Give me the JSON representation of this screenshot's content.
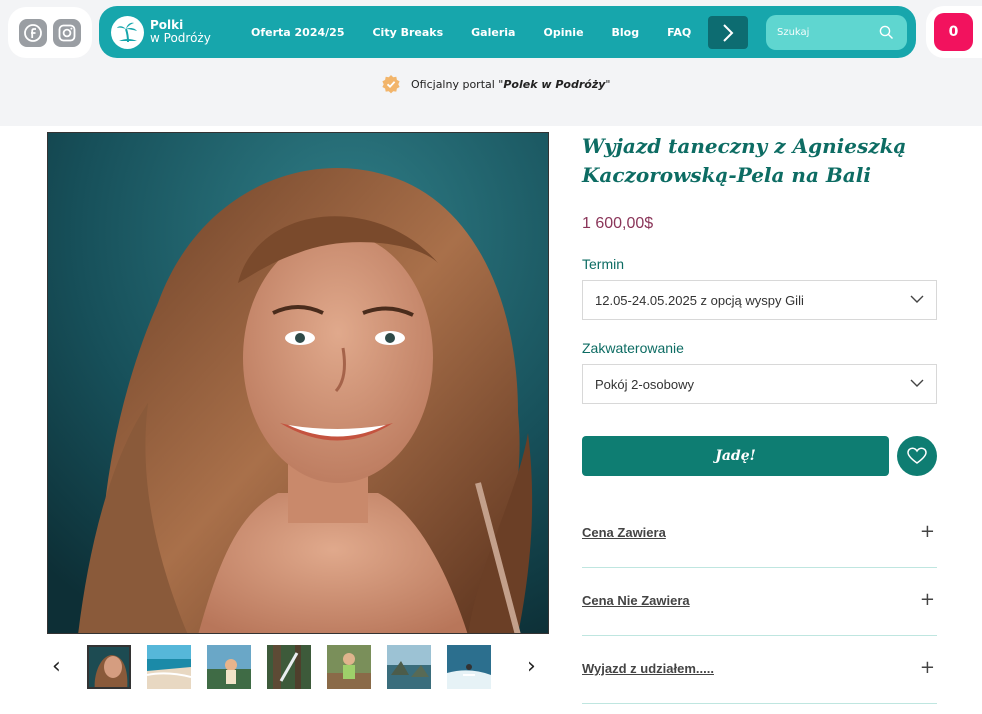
{
  "header": {
    "social": [
      {
        "icon": "facebook-icon"
      },
      {
        "icon": "instagram-icon"
      }
    ],
    "logo": {
      "line1": "Polki",
      "line2": "w Podróży"
    },
    "nav": [
      {
        "label": "Oferta 2024/25"
      },
      {
        "label": "City Breaks"
      },
      {
        "label": "Galeria"
      },
      {
        "label": "Opinie"
      },
      {
        "label": "Blog"
      },
      {
        "label": "FAQ"
      }
    ],
    "search": {
      "placeholder": "Szukaj"
    },
    "cart_count": "0",
    "colors": {
      "nav_bg": "#17a6ac",
      "nav_dark": "#0d6c71",
      "cart": "#f2125e",
      "accent": "#0e7d72"
    }
  },
  "official": {
    "prefix": "Oficjalny portal \"",
    "name": "Polek w Podróży",
    "suffix": "\""
  },
  "gallery": {
    "thumb_count": 7,
    "prev_label": "‹",
    "next_label": "›"
  },
  "product": {
    "title": "Wyjazd taneczny z Agnieszką Kaczorowską-Pela na Bali",
    "price": "1 600,00$",
    "term_label": "Termin",
    "term_value": "12.05-24.05.2025 z opcją wyspy Gili",
    "room_label": "Zakwaterowanie",
    "room_value": "Pokój 2-osobowy",
    "cta": "Jadę!",
    "accordion": [
      {
        "label": "Cena Zawiera"
      },
      {
        "label": "Cena Nie Zawiera"
      },
      {
        "label": "Wyjazd z udziałem....."
      }
    ]
  }
}
